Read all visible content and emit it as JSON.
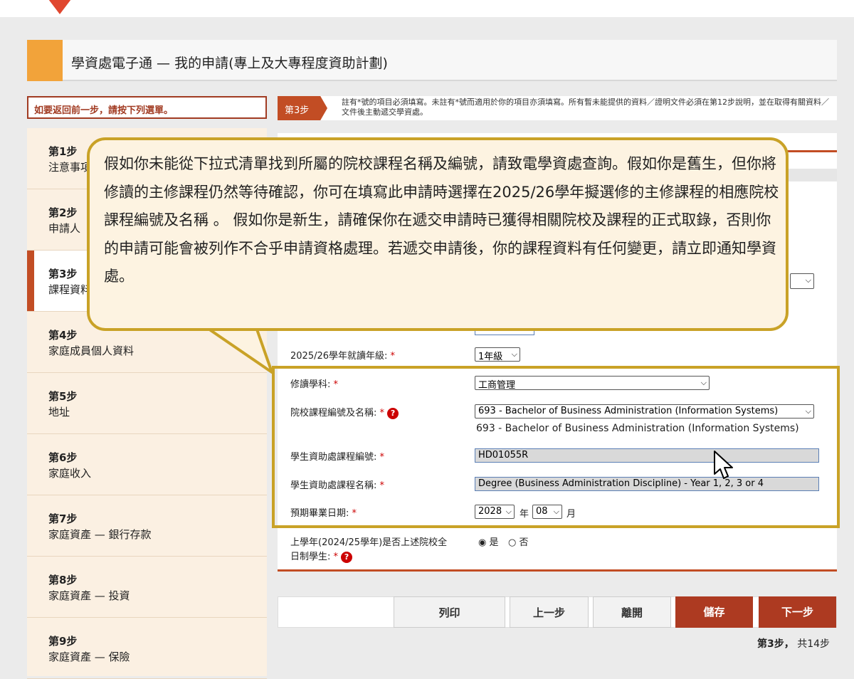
{
  "header": {
    "title": "學資處電子通 — 我的申請(專上及大專程度資助計劃)"
  },
  "back_note": "如要返回前一步，請按下列選單。",
  "step_note": {
    "tag": "第3步",
    "text": "註有*號的項目必須填寫。未註有*號而適用於你的項目亦須填寫。所有暫未能提供的資料／證明文件必須在第12步說明，並在取得有關資料／文件後主動遞交學資處。"
  },
  "sidebar": {
    "items": [
      {
        "num": "第1步",
        "name": "注意事項"
      },
      {
        "num": "第2步",
        "name": "申請人"
      },
      {
        "num": "第3步",
        "name": "課程資料"
      },
      {
        "num": "第4步",
        "name": "家庭成員個人資料"
      },
      {
        "num": "第5步",
        "name": "地址"
      },
      {
        "num": "第6步",
        "name": "家庭收入"
      },
      {
        "num": "第7步",
        "name": "家庭資產 — 銀行存款"
      },
      {
        "num": "第8步",
        "name": "家庭資產 — 投資"
      },
      {
        "num": "第9步",
        "name": "家庭資產 — 保險"
      }
    ]
  },
  "form": {
    "year_label": "2025/26學年就讀年級:",
    "year_value": "1年級",
    "subject_label": "修讀學科:",
    "subject_value": "工商管理",
    "course_label": "院校課程編號及名稱:",
    "course_value": "693 - Bachelor of Business Administration (Information Systems)",
    "course_text": "693 - Bachelor of Business Administration (Information Systems)",
    "sfo_code_label": "學生資助處課程編號:",
    "sfo_code_value": "HD01055R",
    "sfo_name_label": "學生資助處課程名稱:",
    "sfo_name_value": "Degree (Business Administration Discipline) - Year 1, 2, 3 or 4",
    "grad_label": "預期畢業日期:",
    "grad_year": "2028",
    "year_unit": "年",
    "grad_month": "08",
    "month_unit": "月",
    "fulltime_label_1": "上學年(2024/25學年)是否上述院校全",
    "fulltime_label_2": "日制學生:",
    "yes_label": "是",
    "no_label": "否",
    "required_mark": "*"
  },
  "buttons": {
    "print": "列印",
    "prev": "上一步",
    "leave": "離開",
    "save": "儲存",
    "next": "下一步"
  },
  "page_count": {
    "current": "第3步，",
    "total": "共14步"
  },
  "callout": {
    "text": "假如你未能從下拉式清單找到所屬的院校課程名稱及編號，請致電學資處查詢。假如你是舊生，但你將修讀的主修課程仍然等待確認，你可在填寫此申請時選擇在2025/26學年擬選修的主修課程的相應院校課程編號及名稱 。 假如你是新生，請確保你在遞交申請時已獲得相關院校及課程的正式取錄，否則你的申請可能會被列作不合乎申請資格處理。若遞交申請後，你的課程資料有任何變更，請立即通知學資處。"
  },
  "colors": {
    "accent": "#c24d24",
    "orange": "#f2a33a",
    "highlight": "#c9a227"
  }
}
